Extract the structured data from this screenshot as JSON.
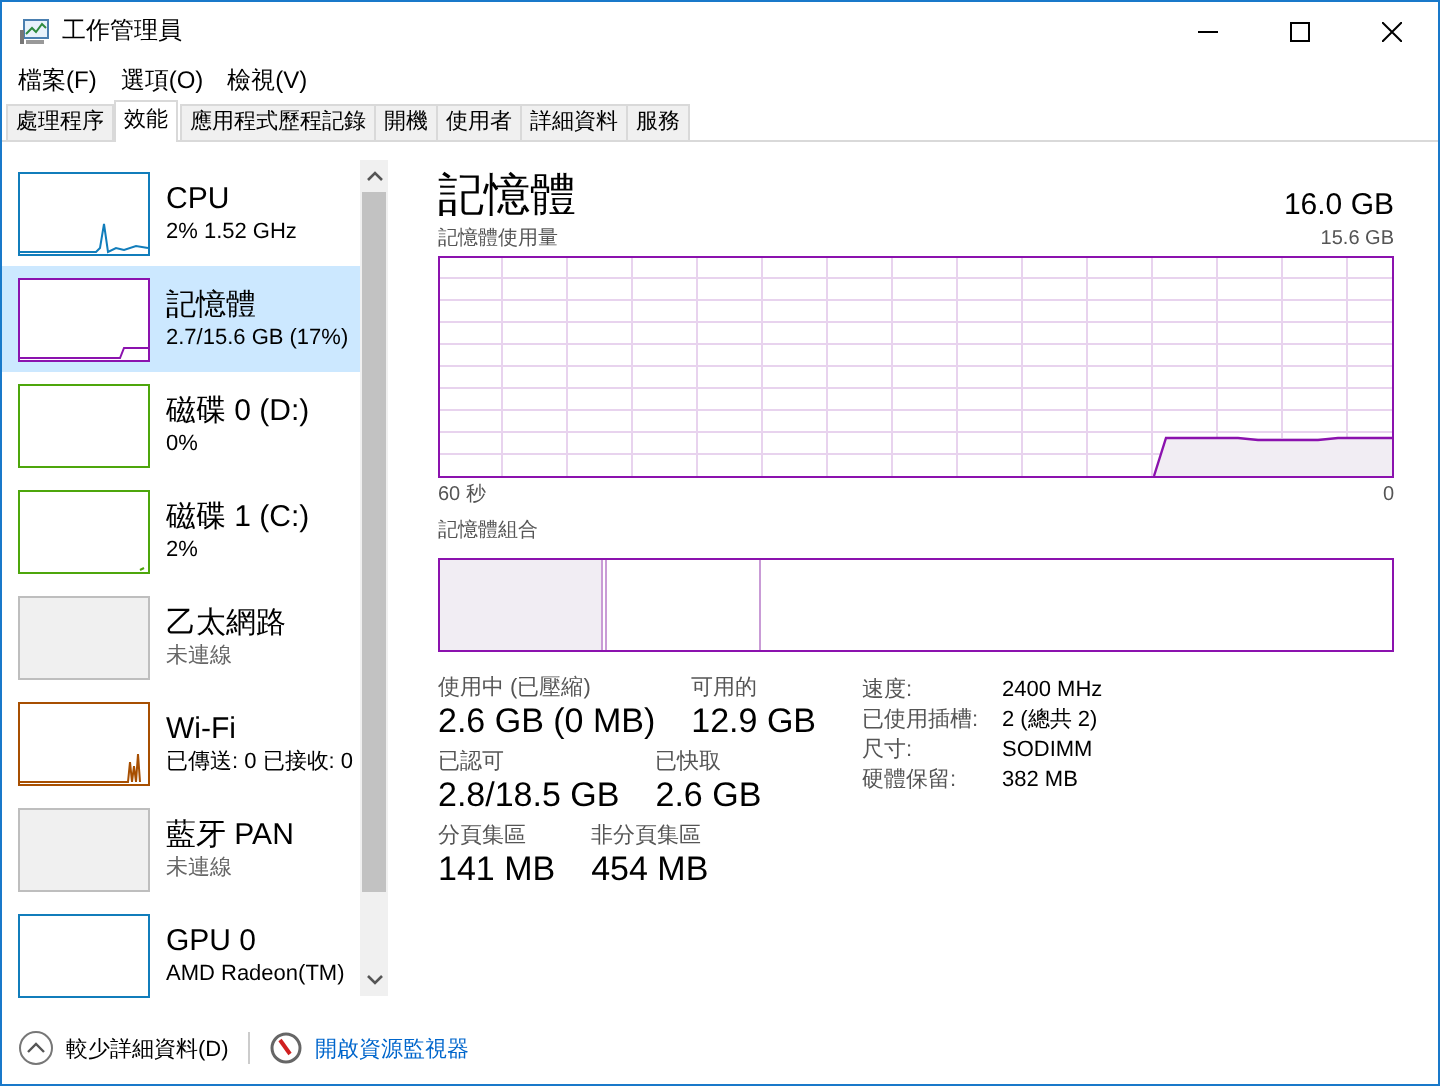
{
  "window": {
    "title": "工作管理員"
  },
  "menu": [
    {
      "label": "檔案(F)"
    },
    {
      "label": "選項(O)"
    },
    {
      "label": "檢視(V)"
    }
  ],
  "tabs": [
    {
      "label": "處理程序",
      "selected": false
    },
    {
      "label": "效能",
      "selected": true
    },
    {
      "label": "應用程式歷程記錄",
      "selected": false
    },
    {
      "label": "開機",
      "selected": false
    },
    {
      "label": "使用者",
      "selected": false
    },
    {
      "label": "詳細資料",
      "selected": false
    },
    {
      "label": "服務",
      "selected": false
    }
  ],
  "sidebar": {
    "items": [
      {
        "kind": "graph",
        "name": "CPU",
        "detail": "2% 1.52 GHz",
        "color": "#117dbb",
        "selected": false
      },
      {
        "kind": "graph",
        "name": "記憶體",
        "detail": "2.7/15.6 GB (17%)",
        "color": "#8b12ae",
        "selected": true
      },
      {
        "kind": "graph",
        "name": "磁碟 0 (D:)",
        "detail": "0%",
        "color": "#4da60c",
        "selected": false
      },
      {
        "kind": "graph",
        "name": "磁碟 1 (C:)",
        "detail": "2%",
        "color": "#4da60c",
        "selected": false
      },
      {
        "kind": "idle",
        "name": "乙太網路",
        "detail": "未連線",
        "color": "#bebebe",
        "selected": false
      },
      {
        "kind": "graph",
        "name": "Wi-Fi",
        "detail": "已傳送: 0 已接收: 0",
        "color": "#a74f01",
        "selected": false
      },
      {
        "kind": "idle",
        "name": "藍牙 PAN",
        "detail": "未連線",
        "color": "#bebebe",
        "selected": false
      },
      {
        "kind": "graph",
        "name": "GPU 0",
        "detail": "AMD Radeon(TM)",
        "color": "#117dbb",
        "selected": false
      }
    ]
  },
  "memory": {
    "title": "記憶體",
    "total": "16.0 GB",
    "usage_label": "記憶體使用量",
    "usage_max": "15.6 GB",
    "axis_start": "60 秒",
    "axis_end": "0",
    "composition_label": "記憶體組合",
    "stat_rows": [
      {
        "items": [
          {
            "label": "使用中 (已壓縮)",
            "value": "2.6 GB (0 MB)"
          },
          {
            "label": "可用的",
            "value": "12.9 GB"
          }
        ]
      },
      {
        "items": [
          {
            "label": "已認可",
            "value": "2.8/18.5 GB"
          },
          {
            "label": "已快取",
            "value": "2.6 GB"
          }
        ]
      },
      {
        "items": [
          {
            "label": "分頁集區",
            "value": "141 MB"
          },
          {
            "label": "非分頁集區",
            "value": "454 MB"
          }
        ]
      }
    ],
    "details": [
      {
        "label": "速度:",
        "value": "2400 MHz"
      },
      {
        "label": "已使用插槽:",
        "value": "2 (總共 2)"
      },
      {
        "label": "尺寸:",
        "value": "SODIMM"
      },
      {
        "label": "硬體保留:",
        "value": "382 MB"
      }
    ]
  },
  "footer": {
    "fewer_details": "較少詳細資料(D)",
    "resource_monitor": "開啟資源監視器"
  }
}
